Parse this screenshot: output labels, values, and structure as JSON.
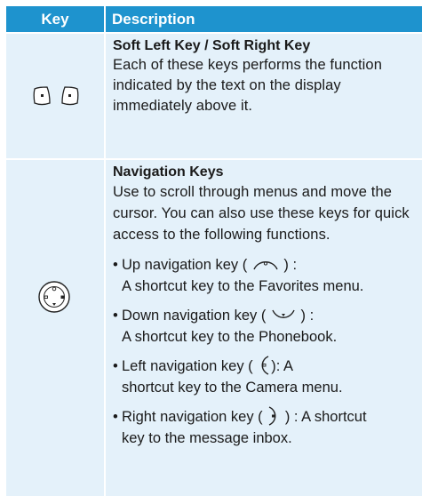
{
  "table": {
    "header": {
      "key": "Key",
      "description": "Description"
    },
    "rows": [
      {
        "key_icons": [
          "soft-left-key-icon",
          "soft-right-key-icon"
        ],
        "title": "Soft Left Key / Soft Right Key",
        "text": "Each of these keys performs the function indicated by the text on the display immediately above it."
      },
      {
        "key_icons": [
          "navigation-key-icon"
        ],
        "title": "Navigation Keys",
        "text": "Use to scroll through menus and move the cursor. You can also use these keys for quick access to the following functions.",
        "bullets": [
          {
            "icon": "up-navigation-key-icon",
            "before": "Up navigation key ( ",
            "after": " ) :",
            "detail": "A shortcut key to the Favorites menu."
          },
          {
            "icon": "down-navigation-key-icon",
            "before": "Down navigation key ( ",
            "after": " ) :",
            "detail": "A shortcut key to the Phonebook."
          },
          {
            "icon": "left-navigation-key-icon",
            "before": "Left navigation key ( ",
            "after": "): A",
            "detail": "shortcut key to the Camera menu."
          },
          {
            "icon": "right-navigation-key-icon",
            "before": "Right navigation key ( ",
            "after": " ) : A shortcut",
            "detail": "key to the message inbox."
          }
        ]
      }
    ]
  },
  "colors": {
    "header_bg": "#1e93ce",
    "cell_bg": "#e4f1fa",
    "header_text": "#ffffff"
  }
}
